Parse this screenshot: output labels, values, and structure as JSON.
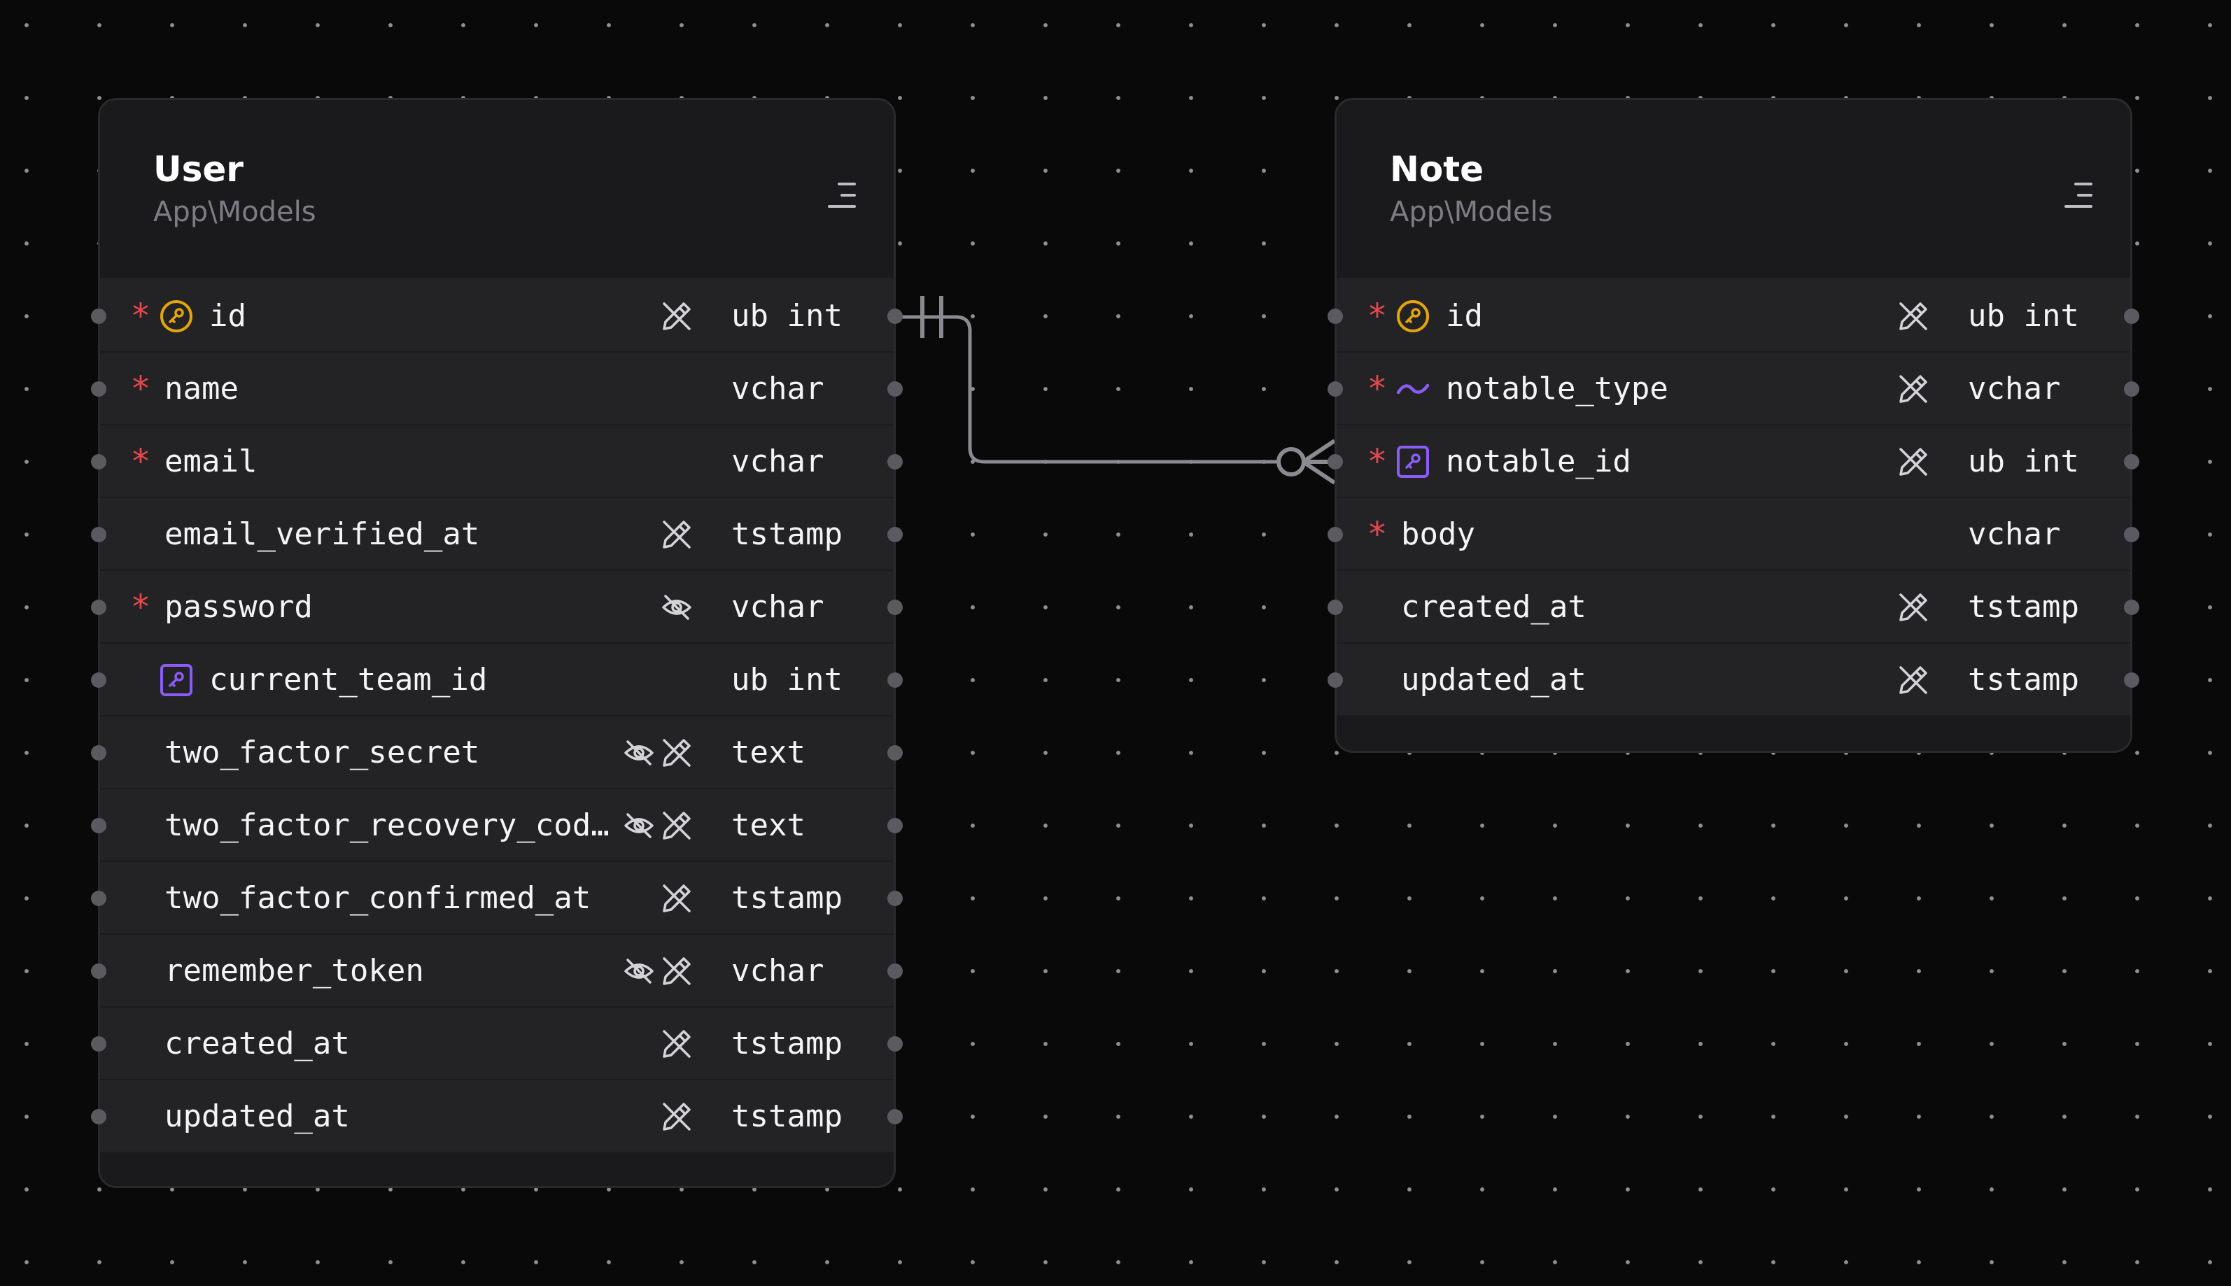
{
  "models": [
    {
      "id": "user",
      "name": "User",
      "namespace": "App\\Models",
      "fields": [
        {
          "name": "id",
          "type": "ub int",
          "required": true,
          "key": "primary",
          "flags": [
            "fillable-off"
          ]
        },
        {
          "name": "name",
          "type": "vchar",
          "required": true,
          "key": null,
          "flags": []
        },
        {
          "name": "email",
          "type": "vchar",
          "required": true,
          "key": null,
          "flags": []
        },
        {
          "name": "email_verified_at",
          "type": "tstamp",
          "required": false,
          "key": null,
          "flags": [
            "fillable-off"
          ]
        },
        {
          "name": "password",
          "type": "vchar",
          "required": true,
          "key": null,
          "flags": [
            "hidden"
          ]
        },
        {
          "name": "current_team_id",
          "type": "ub int",
          "required": false,
          "key": "foreign",
          "flags": []
        },
        {
          "name": "two_factor_secret",
          "type": "text",
          "required": false,
          "key": null,
          "flags": [
            "hidden",
            "fillable-off"
          ]
        },
        {
          "name": "two_factor_recovery_cod…",
          "type": "text",
          "required": false,
          "key": null,
          "flags": [
            "hidden",
            "fillable-off"
          ]
        },
        {
          "name": "two_factor_confirmed_at",
          "type": "tstamp",
          "required": false,
          "key": null,
          "flags": [
            "fillable-off"
          ]
        },
        {
          "name": "remember_token",
          "type": "vchar",
          "required": false,
          "key": null,
          "flags": [
            "hidden",
            "fillable-off"
          ]
        },
        {
          "name": "created_at",
          "type": "tstamp",
          "required": false,
          "key": null,
          "flags": [
            "fillable-off"
          ]
        },
        {
          "name": "updated_at",
          "type": "tstamp",
          "required": false,
          "key": null,
          "flags": [
            "fillable-off"
          ]
        }
      ]
    },
    {
      "id": "note",
      "name": "Note",
      "namespace": "App\\Models",
      "fields": [
        {
          "name": "id",
          "type": "ub int",
          "required": true,
          "key": "primary",
          "flags": [
            "fillable-off"
          ]
        },
        {
          "name": "notable_type",
          "type": "vchar",
          "required": true,
          "key": "morph",
          "flags": [
            "fillable-off"
          ]
        },
        {
          "name": "notable_id",
          "type": "ub int",
          "required": true,
          "key": "foreign",
          "flags": [
            "fillable-off"
          ]
        },
        {
          "name": "body",
          "type": "vchar",
          "required": true,
          "key": null,
          "flags": []
        },
        {
          "name": "created_at",
          "type": "tstamp",
          "required": false,
          "key": null,
          "flags": [
            "fillable-off"
          ]
        },
        {
          "name": "updated_at",
          "type": "tstamp",
          "required": false,
          "key": null,
          "flags": [
            "fillable-off"
          ]
        }
      ]
    }
  ],
  "relation": {
    "from": "user.id",
    "to": "note.notable_id",
    "from_cardinality": "one-and-only-one",
    "to_cardinality": "zero-or-many"
  },
  "icons": {
    "required": "asterisk",
    "primary": "key-circle-icon",
    "foreign": "key-square-icon",
    "morph": "tilde-icon",
    "hidden": "eye-off-icon",
    "fillable-off": "pencil-off-icon",
    "menu": "menu-icon"
  },
  "colors": {
    "background": "#09090a",
    "card": "#1a1a1c",
    "row": "#232326",
    "required": "#e5484d",
    "primary_key": "#e5a50a",
    "foreign_key": "#8b5cf6",
    "connector": "#8a8a90"
  }
}
